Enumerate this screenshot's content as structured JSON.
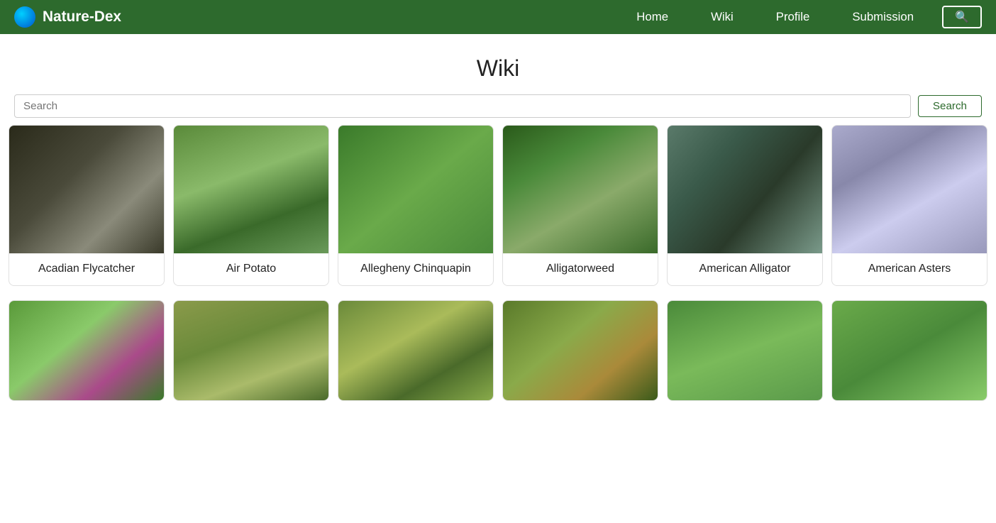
{
  "nav": {
    "logo_text": "Nature-Dex",
    "links": [
      "Home",
      "Wiki",
      "Profile",
      "Submission"
    ],
    "search_btn": "🔍"
  },
  "page": {
    "title": "Wiki"
  },
  "search": {
    "placeholder": "Search",
    "button_label": "Search"
  },
  "grid_row1": [
    {
      "id": "acadian-flycatcher",
      "name": "Acadian Flycatcher",
      "img_class": "img-bird"
    },
    {
      "id": "air-potato",
      "name": "Air Potato",
      "img_class": "img-airpotato"
    },
    {
      "id": "allegheny-chinquapin",
      "name": "Allegheny Chinquapin",
      "img_class": "img-alleghenychin"
    },
    {
      "id": "alligatorweed",
      "name": "Alligatorweed",
      "img_class": "img-alligatorweed"
    },
    {
      "id": "american-alligator",
      "name": "American Alligator",
      "img_class": "img-alligator"
    },
    {
      "id": "american-aster",
      "name": "American Asters",
      "img_class": "img-americanaster"
    }
  ],
  "grid_row2": [
    {
      "id": "beautyberry",
      "name": "",
      "img_class": "img-beautyberry"
    },
    {
      "id": "tree1",
      "name": "",
      "img_class": "img-tree1"
    },
    {
      "id": "tree2",
      "name": "",
      "img_class": "img-tree2"
    },
    {
      "id": "frog",
      "name": "",
      "img_class": "img-frog"
    },
    {
      "id": "plant1",
      "name": "",
      "img_class": "img-plant1"
    },
    {
      "id": "leaf",
      "name": "",
      "img_class": "img-leaf"
    }
  ]
}
